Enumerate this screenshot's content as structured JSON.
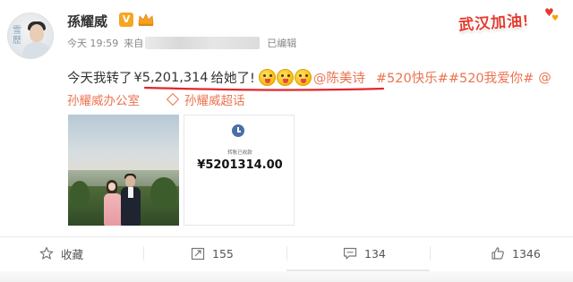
{
  "post": {
    "author": "孫耀威",
    "avatar_text": "雪 歷",
    "verified_badge": "V",
    "time": "今天 19:59",
    "source_prefix": "来自",
    "edited": "已编辑",
    "text_main": "今天我转了",
    "text_amount": "¥5,201,314",
    "text_suffix": "给她了!",
    "mention": "@陈美诗",
    "topics": "#520快乐##520我爱你#",
    "trailing_at": "@",
    "office_link": "孙耀威办公室",
    "super_topic": "孙耀威超话"
  },
  "sticker": {
    "text": "武汉加油!"
  },
  "receipt": {
    "caption": "转账已收款",
    "amount": "¥5201314.00"
  },
  "actions": {
    "favorite": "收藏",
    "repost_count": "155",
    "comment_count": "134",
    "like_count": "1346"
  },
  "colors": {
    "link": "#eb7350",
    "underline": "#e0262d",
    "accent": "#f5a623"
  },
  "icons": [
    "verified-v-icon",
    "crown-icon",
    "smile-emoji-icon",
    "super-topic-diamond-icon",
    "clock-icon",
    "star-icon",
    "repost-icon",
    "comment-icon",
    "like-icon"
  ]
}
